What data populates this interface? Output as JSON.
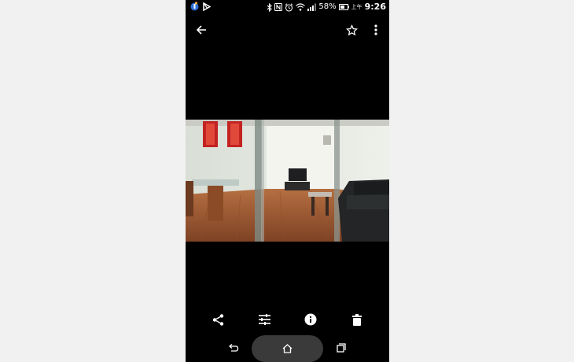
{
  "status_bar": {
    "battery": "58%",
    "ampm": "上午",
    "time": "9:26",
    "left_icons": [
      "app-notification-icon",
      "play-store-icon"
    ],
    "right_icons": [
      "bluetooth-icon",
      "nfc-icon",
      "alarm-icon",
      "wifi-icon",
      "signal-icon",
      "battery-icon"
    ]
  },
  "toolbar": {
    "back_icon": "arrow-back-icon",
    "favorite_icon": "star-outline-icon",
    "more_icon": "more-vert-icon"
  },
  "photo": {
    "subject": "office-lounge-photo",
    "colors": {
      "floor": "#a8643a",
      "wall": "#e9ebe6",
      "sofa": "#232526"
    }
  },
  "actions": {
    "icons": [
      "share-icon",
      "tune-icon",
      "info-icon",
      "delete-icon"
    ]
  },
  "nav_bar": {
    "icons": [
      "back-icon",
      "home-icon",
      "recents-icon"
    ]
  },
  "colors": {
    "screen_bg": "#000000",
    "outer_bg": "#f1f1f1",
    "nav_pill": "#3a3a3a",
    "icon": "#ffffff"
  }
}
